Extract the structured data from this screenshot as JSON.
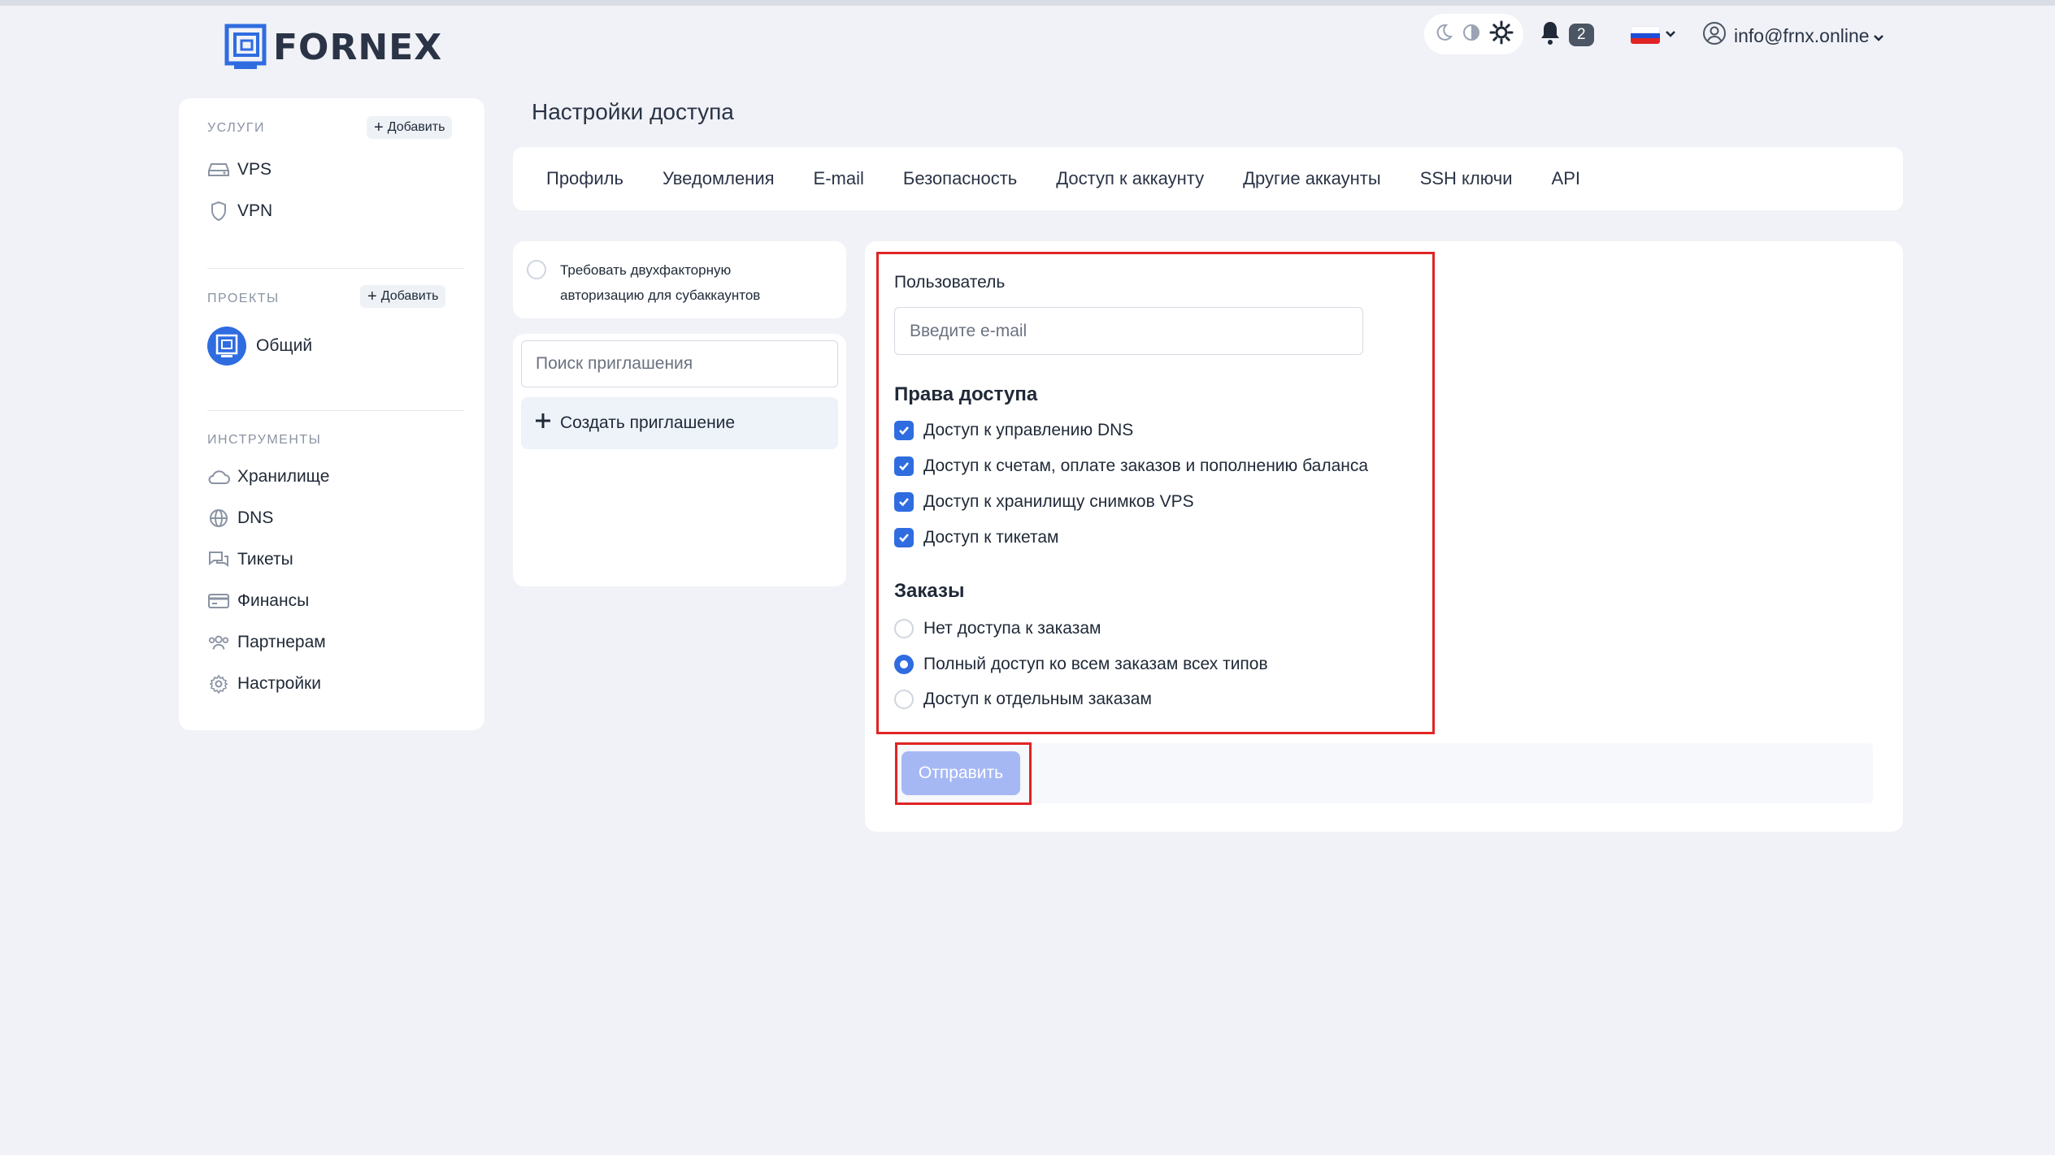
{
  "app": {
    "logo_text": "FORNEX",
    "brand_color": "#2f6ce0"
  },
  "header": {
    "notifications_count": "2",
    "user_email": "info@frnx.online",
    "icons": [
      "moon-icon",
      "half-moon-icon",
      "sun-icon",
      "bell-icon",
      "flag-ru-icon",
      "user-icon",
      "chevron-down-icon"
    ]
  },
  "sidebar": {
    "services_head": "УСЛУГИ",
    "add_label": "Добавить",
    "services": [
      {
        "label": "VPS",
        "icon": "server-icon"
      },
      {
        "label": "VPN",
        "icon": "shield-icon"
      }
    ],
    "projects_head": "ПРОЕКТЫ",
    "projects": [
      {
        "label": "Общий",
        "icon": "project-icon"
      }
    ],
    "tools_head": "ИНСТРУМЕНТЫ",
    "tools": [
      {
        "label": "Хранилище",
        "icon": "cloud-icon"
      },
      {
        "label": "DNS",
        "icon": "globe-icon"
      },
      {
        "label": "Тикеты",
        "icon": "chat-icon"
      },
      {
        "label": "Финансы",
        "icon": "card-icon"
      },
      {
        "label": "Партнерам",
        "icon": "users-icon"
      },
      {
        "label": "Настройки",
        "icon": "gear-icon"
      }
    ]
  },
  "main": {
    "title": "Настройки доступа",
    "tabs": [
      "Профиль",
      "Уведомления",
      "E-mail",
      "Безопасность",
      "Доступ к аккаунту",
      "Другие аккаунты",
      "SSH ключи",
      "API"
    ],
    "twofa_label_1": "Требовать двухфакторную",
    "twofa_label_2": "авторизацию для субаккаунтов",
    "search_placeholder": "Поиск приглашения",
    "create_invite": "Создать приглашение"
  },
  "form": {
    "user_label": "Пользователь",
    "email_placeholder": "Введите e-mail",
    "rights_title": "Права доступа",
    "rights": [
      {
        "label": "Доступ к управлению DNS",
        "checked": true
      },
      {
        "label": "Доступ к счетам, оплате заказов и пополнению баланса",
        "checked": true
      },
      {
        "label": "Доступ к хранилищу снимков VPS",
        "checked": true
      },
      {
        "label": "Доступ к тикетам",
        "checked": true
      }
    ],
    "orders_title": "Заказы",
    "orders": [
      {
        "label": "Нет доступа к заказам",
        "selected": false
      },
      {
        "label": "Полный доступ ко всем заказам всех типов",
        "selected": true
      },
      {
        "label": "Доступ к отдельным заказам",
        "selected": false
      }
    ],
    "submit_label": "Отправить"
  }
}
